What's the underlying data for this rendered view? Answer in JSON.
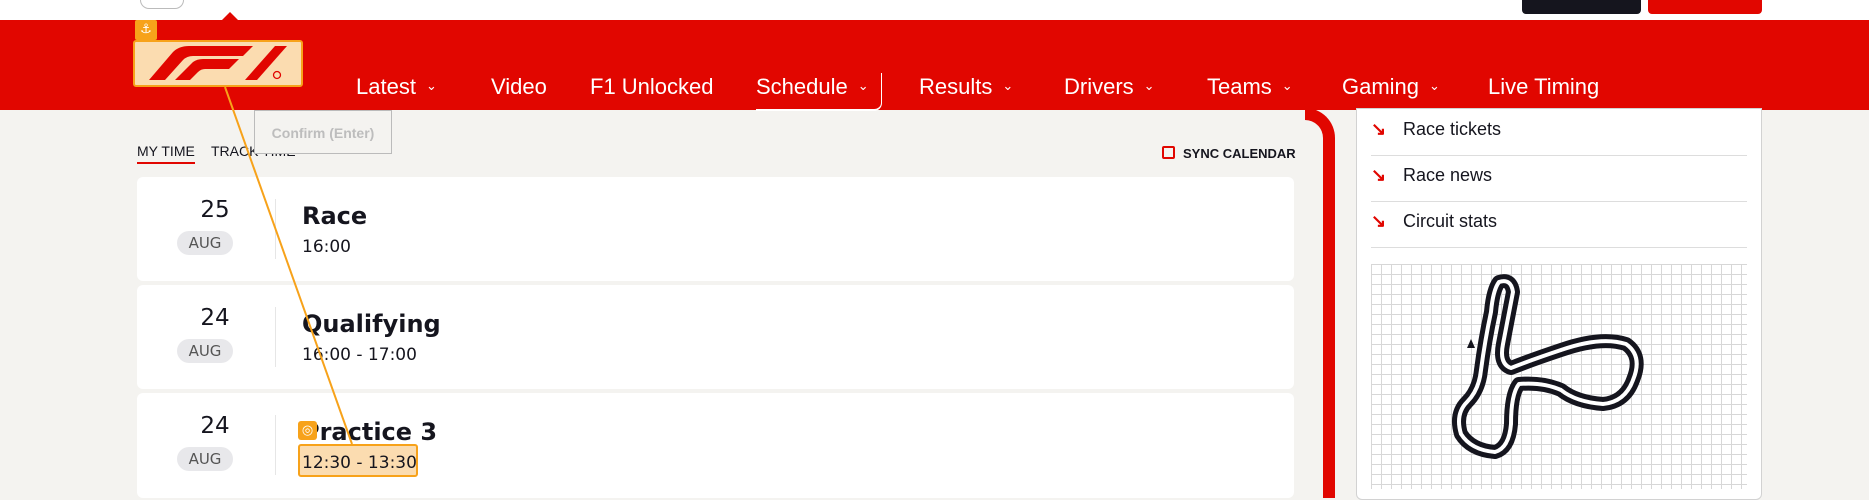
{
  "nav": {
    "items": [
      {
        "label": "Latest",
        "has_menu": true
      },
      {
        "label": "Video",
        "has_menu": false
      },
      {
        "label": "F1 Unlocked",
        "has_menu": false
      },
      {
        "label": "Schedule",
        "has_menu": true
      },
      {
        "label": "Results",
        "has_menu": true
      },
      {
        "label": "Drivers",
        "has_menu": true
      },
      {
        "label": "Teams",
        "has_menu": true
      },
      {
        "label": "Gaming",
        "has_menu": true
      },
      {
        "label": "Live Timing",
        "has_menu": false
      }
    ],
    "active": "Schedule",
    "brand_color": "#e10600"
  },
  "tooltip": {
    "text": "Confirm (Enter)"
  },
  "time_tabs": {
    "my_time": "MY TIME",
    "track_time": "TRACK TIME",
    "active": "MY TIME"
  },
  "sync_calendar": "SYNC CALENDAR",
  "sessions": [
    {
      "day": "25",
      "month": "AUG",
      "name": "Race",
      "time": "16:00"
    },
    {
      "day": "24",
      "month": "AUG",
      "name": "Qualifying",
      "time": "16:00 - 17:00"
    },
    {
      "day": "24",
      "month": "AUG",
      "name": "Practice 3",
      "time": "12:30 - 13:30"
    }
  ],
  "sidebar": {
    "links": [
      {
        "label": "Race tickets",
        "icon": "arrow-down-right-icon"
      },
      {
        "label": "Race news",
        "icon": "arrow-down-right-icon"
      },
      {
        "label": "Circuit stats",
        "icon": "arrow-down-right-icon"
      }
    ],
    "map_icon": "circuit-map"
  },
  "annotation": {
    "highlight_color": "#f7a21a"
  }
}
